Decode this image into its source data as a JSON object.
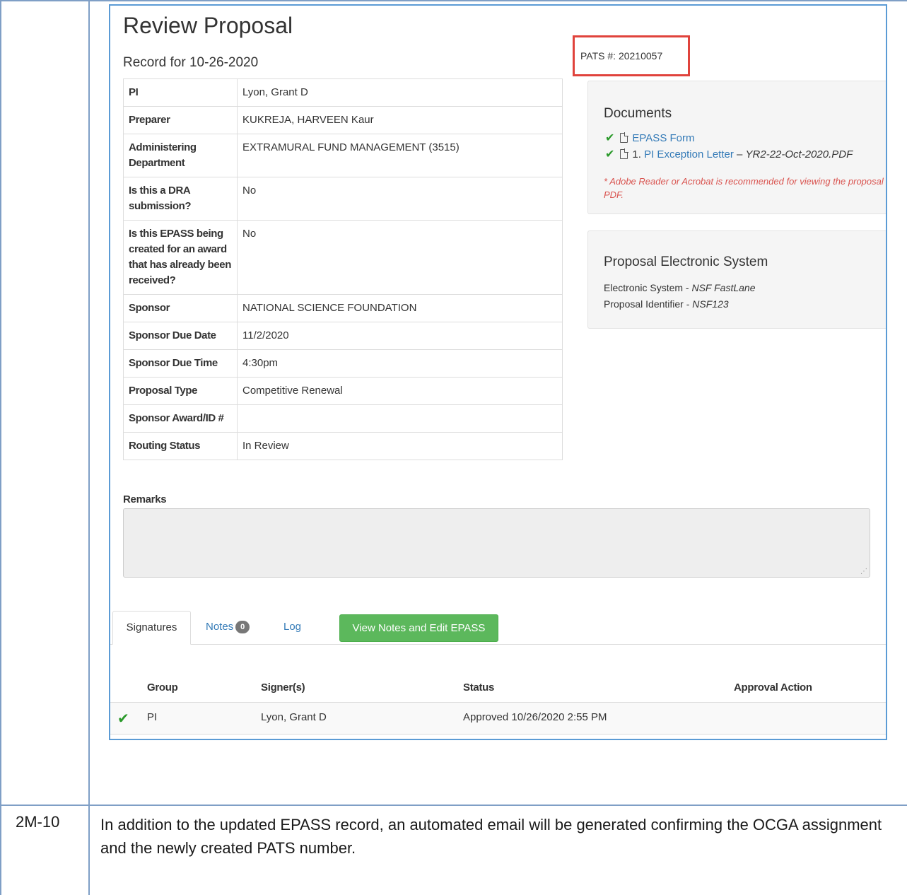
{
  "proposal": {
    "title": "Review Proposal",
    "record_for": "Record for 10-26-2020",
    "pats": "PATS #: 20210057"
  },
  "info": [
    {
      "label": "PI",
      "value": "Lyon, Grant D"
    },
    {
      "label": "Preparer",
      "value": "KUKREJA, HARVEEN Kaur"
    },
    {
      "label": "Administering Department",
      "value": "EXTRAMURAL FUND MANAGEMENT (3515)"
    },
    {
      "label": "Is this a DRA submission?",
      "value": "No"
    },
    {
      "label": "Is this EPASS being created for an award that has already been received?",
      "value": "No"
    },
    {
      "label": "Sponsor",
      "value": "NATIONAL SCIENCE FOUNDATION"
    },
    {
      "label": "Sponsor Due Date",
      "value": "11/2/2020"
    },
    {
      "label": "Sponsor Due Time",
      "value": "4:30pm"
    },
    {
      "label": "Proposal Type",
      "value": "Competitive Renewal"
    },
    {
      "label": "Sponsor Award/ID #",
      "value": ""
    },
    {
      "label": "Routing Status",
      "value": "In Review"
    }
  ],
  "documents": {
    "title": "Documents",
    "items": [
      {
        "prefix": "",
        "link": "EPASS Form",
        "dash": "",
        "file": ""
      },
      {
        "prefix": "1. ",
        "link": "PI Exception Letter",
        "dash": " – ",
        "file": "YR2-22-Oct-2020.PDF"
      }
    ],
    "note": "* Adobe Reader or Acrobat is recommended for viewing the proposal PDF.",
    "check_color": "#2b9a2b",
    "file_icon": "file-icon"
  },
  "electronic_system": {
    "title": "Proposal Electronic System",
    "system_label": "Electronic System - ",
    "system_value": "NSF FastLane",
    "id_label": "Proposal Identifier - ",
    "id_value": "NSF123"
  },
  "remarks": {
    "label": "Remarks",
    "value": ""
  },
  "tabs": {
    "signatures": "Signatures",
    "notes": "Notes",
    "notes_count": "0",
    "log": "Log",
    "edit_button": "View Notes and Edit EPASS",
    "edit_button_color": "#5cb85c"
  },
  "signatures": {
    "headers": [
      "Group",
      "Signer(s)",
      "Status",
      "Approval Action"
    ],
    "rows": [
      {
        "group": "PI",
        "signer": "Lyon, Grant D",
        "status": "Approved 10/26/2020 2:55 PM",
        "action": ""
      }
    ]
  },
  "step": {
    "id": "2M-10",
    "text": "In addition to the updated EPASS record, an automated email will be generated confirming the OCGA assignment and the newly created PATS number."
  },
  "colors": {
    "link": "#337ab7",
    "highlight_box": "#e0433c",
    "frame": "#5b9bd5"
  }
}
